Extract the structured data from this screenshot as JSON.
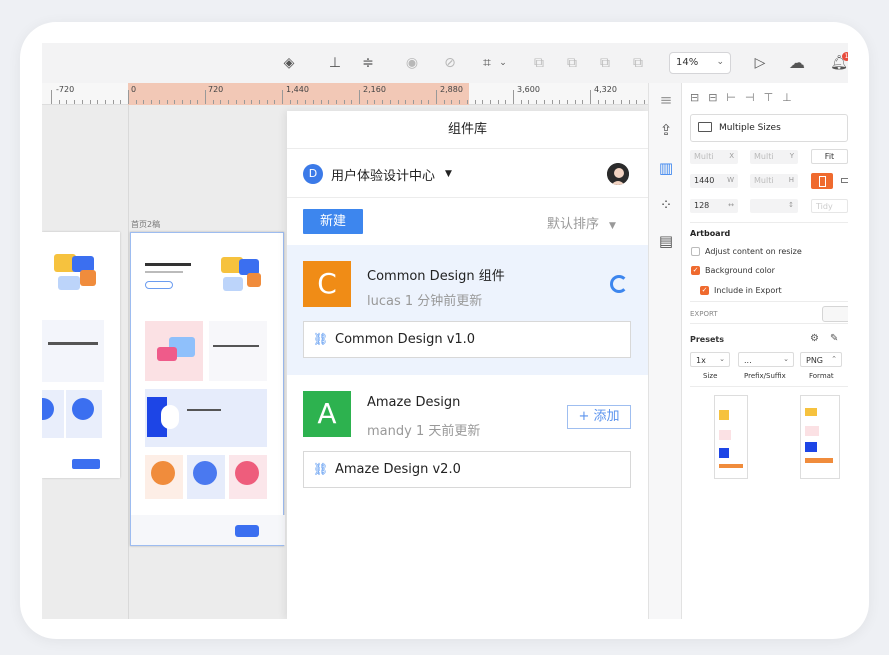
{
  "toolbar": {
    "zoom_value": "14%",
    "notification_count": "1"
  },
  "ruler": {
    "labels": [
      "-720",
      "0",
      "720",
      "1,440",
      "2,160",
      "2,880",
      "3,600",
      "4,320"
    ]
  },
  "canvas": {
    "artboard_label": "首页2稿"
  },
  "library": {
    "title": "组件库",
    "team_initial": "D",
    "team_name": "用户体验设计中心",
    "new_button": "新建",
    "sort_label": "默认排序",
    "items": [
      {
        "initial": "C",
        "color": "#f08c16",
        "name": "Common Design 组件",
        "meta": "lucas 1 分钟前更新",
        "version": "Common Design v1.0"
      },
      {
        "initial": "A",
        "color": "#2db24f",
        "name": "Amaze Design",
        "meta": "mandy 1 天前更新",
        "version": "Amaze Design v2.0",
        "add_label": "添加"
      }
    ]
  },
  "inspector": {
    "preset_value": "Multiple Sizes",
    "fields": {
      "multi": "Multi",
      "x_suffix": "X",
      "y_suffix": "Y",
      "w_value": "1440",
      "w_suffix": "W",
      "h_value": "Multi",
      "h_suffix": "H",
      "rotation_value": "128",
      "tidy_label": "Tidy"
    },
    "fit_button": "Fit",
    "artboard_header": "Artboard",
    "adjust_label": "Adjust content on resize",
    "background_label": "Background color",
    "include_export_label": "Include in Export",
    "export_header": "EXPORT",
    "presets_label": "Presets",
    "size_value": "1x",
    "prefix_value": "...",
    "format_value": "PNG",
    "size_label": "Size",
    "prefix_label": "Prefix/Suffix",
    "format_label": "Format"
  },
  "colors": {
    "accent": "#3d86ee",
    "orange": "#ef6a2e",
    "ruler_selection": "#f2c8b6"
  }
}
